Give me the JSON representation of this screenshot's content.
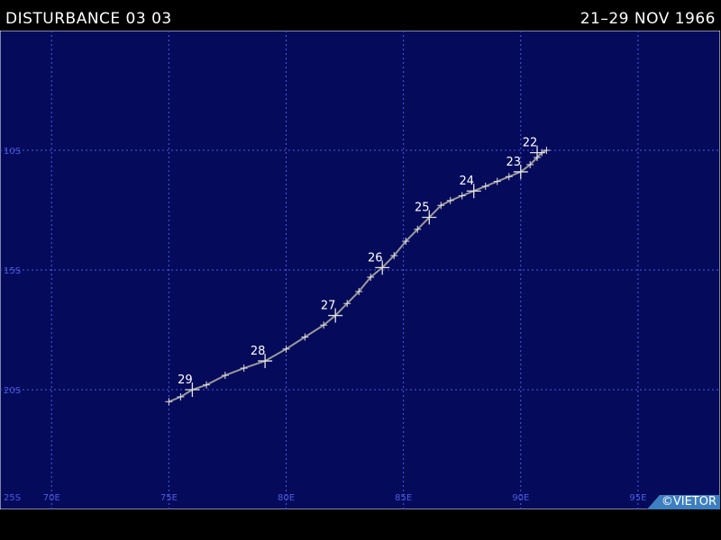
{
  "header": {
    "storm_name": "DISTURBANCE 03 03",
    "date_range": "21–29 NOV 1966"
  },
  "credit": "©VIETOR",
  "colors": {
    "ocean": "#050a5a",
    "grid": "#4a5ee0",
    "grid_label": "#4a5ee0",
    "track": "#9a9a9a",
    "marker": "#e0e0e0",
    "day_label": "#ffffff",
    "credit_bg": "#3d7fc0"
  },
  "chart_data": {
    "type": "map-track",
    "lon_ticks": [
      70,
      75,
      80,
      85,
      90,
      95
    ],
    "lon_labels": [
      "70E",
      "75E",
      "80E",
      "85E",
      "90E",
      "95E"
    ],
    "lat_ticks": [
      -10,
      -15,
      -20,
      -25
    ],
    "lat_labels": [
      "10S",
      "15S",
      "20S",
      "25S"
    ],
    "lon_range": [
      67.8,
      98.5
    ],
    "lat_range": [
      -25.0,
      -5.0
    ],
    "grid": true,
    "track": [
      {
        "lon": 91.1,
        "lat": -10.0
      },
      {
        "lon": 90.9,
        "lat": -10.1
      },
      {
        "lon": 90.7,
        "lat": -10.3
      },
      {
        "lon": 90.4,
        "lat": -10.6
      },
      {
        "lon": 90.0,
        "lat": -10.9
      },
      {
        "lon": 89.5,
        "lat": -11.1
      },
      {
        "lon": 89.0,
        "lat": -11.3
      },
      {
        "lon": 88.5,
        "lat": -11.5
      },
      {
        "lon": 88.0,
        "lat": -11.7
      },
      {
        "lon": 87.5,
        "lat": -11.9
      },
      {
        "lon": 87.0,
        "lat": -12.1
      },
      {
        "lon": 86.6,
        "lat": -12.3
      },
      {
        "lon": 86.1,
        "lat": -12.8
      },
      {
        "lon": 85.6,
        "lat": -13.3
      },
      {
        "lon": 85.1,
        "lat": -13.8
      },
      {
        "lon": 84.6,
        "lat": -14.4
      },
      {
        "lon": 84.1,
        "lat": -14.9
      },
      {
        "lon": 83.6,
        "lat": -15.3
      },
      {
        "lon": 83.1,
        "lat": -15.9
      },
      {
        "lon": 82.6,
        "lat": -16.4
      },
      {
        "lon": 82.1,
        "lat": -16.9
      },
      {
        "lon": 81.6,
        "lat": -17.3
      },
      {
        "lon": 80.8,
        "lat": -17.8
      },
      {
        "lon": 80.0,
        "lat": -18.3
      },
      {
        "lon": 79.1,
        "lat": -18.8
      },
      {
        "lon": 78.2,
        "lat": -19.1
      },
      {
        "lon": 77.4,
        "lat": -19.4
      },
      {
        "lon": 76.6,
        "lat": -19.8
      },
      {
        "lon": 76.0,
        "lat": -20.0
      },
      {
        "lon": 75.5,
        "lat": -20.3
      },
      {
        "lon": 75.0,
        "lat": -20.5
      }
    ],
    "day_marks": [
      {
        "label": "22",
        "lon": 90.7,
        "lat": -10.1
      },
      {
        "label": "23",
        "lon": 90.0,
        "lat": -10.9
      },
      {
        "label": "24",
        "lon": 88.0,
        "lat": -11.7
      },
      {
        "label": "25",
        "lon": 86.1,
        "lat": -12.8
      },
      {
        "label": "26",
        "lon": 84.1,
        "lat": -14.9
      },
      {
        "label": "27",
        "lon": 82.1,
        "lat": -16.9
      },
      {
        "label": "28",
        "lon": 79.1,
        "lat": -18.8
      },
      {
        "label": "29",
        "lon": 76.0,
        "lat": -20.0
      }
    ]
  }
}
